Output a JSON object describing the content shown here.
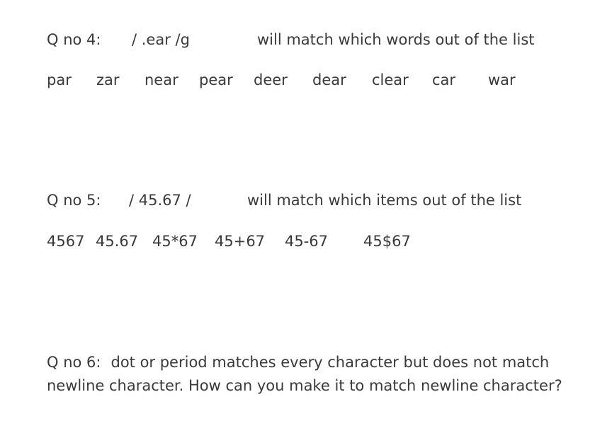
{
  "q4": {
    "label": "Q no 4:",
    "pattern": "/ .ear /g",
    "prompt": "will match which words out of the list",
    "items": [
      "par",
      "zar",
      "near",
      "pear",
      "deer",
      "dear",
      "clear",
      "car",
      "war"
    ]
  },
  "q5": {
    "label": "Q no 5:",
    "pattern": "/ 45.67 /",
    "prompt": "will match which items out of the list",
    "items": [
      "4567",
      "45.67",
      "45*67",
      "45+67",
      "45-67",
      "45$67"
    ]
  },
  "q6": {
    "label": "Q no 6:",
    "text": "dot or period matches every character but does not match newline character. How can you make it to match newline character?"
  }
}
